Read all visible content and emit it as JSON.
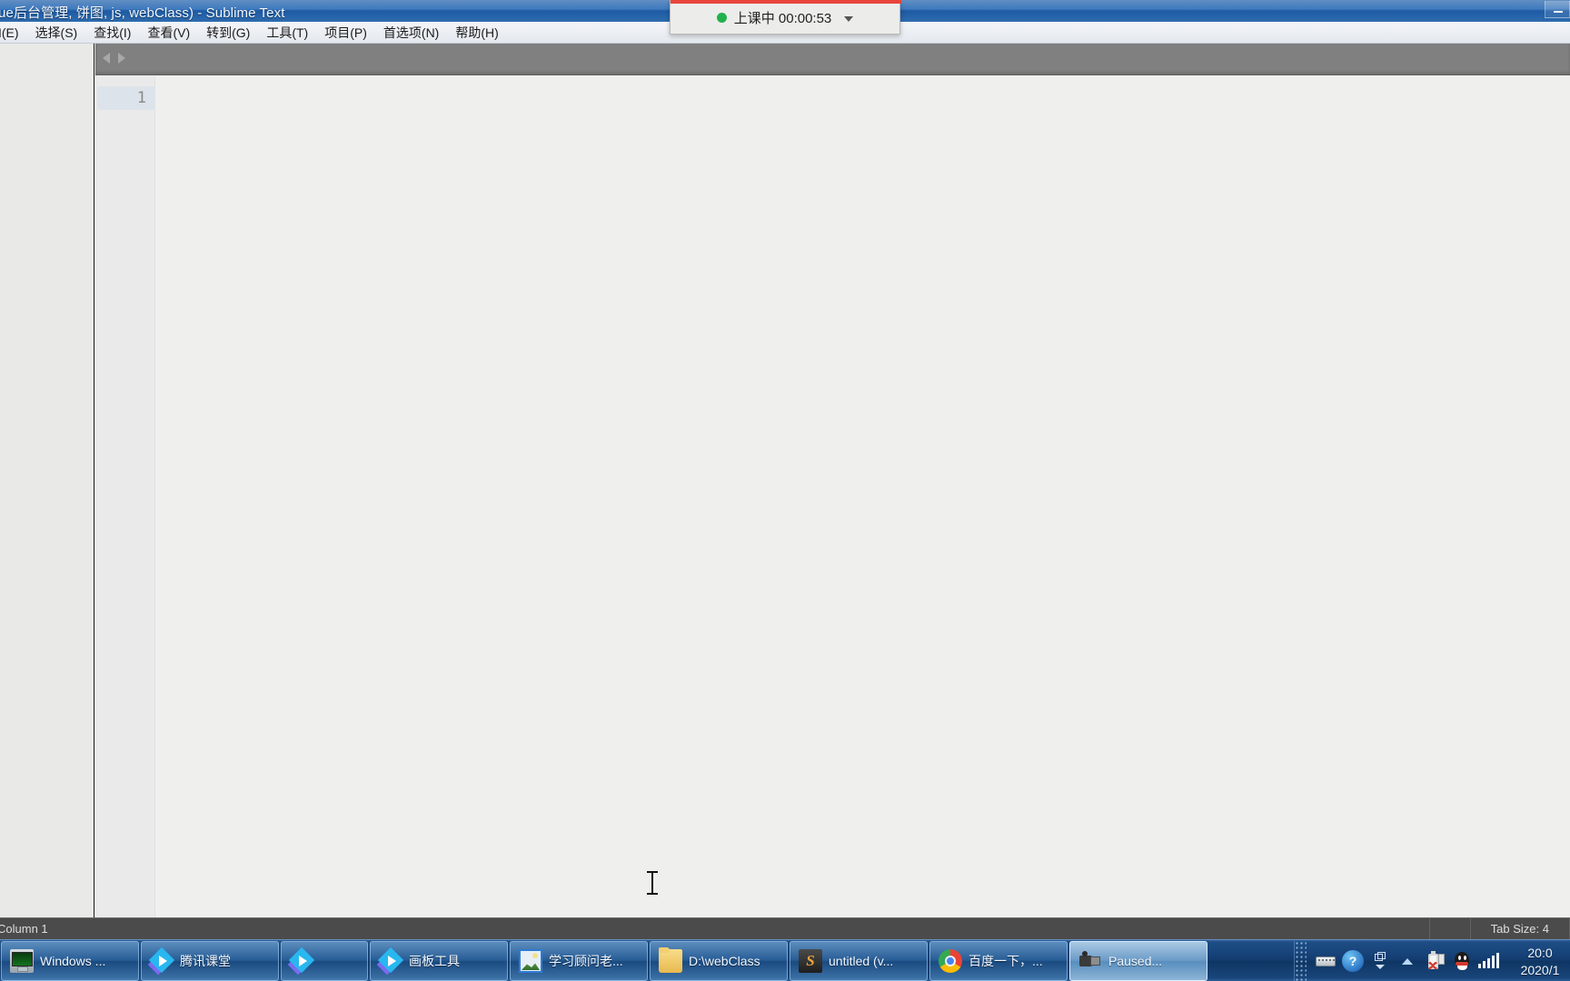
{
  "window": {
    "title": "ue后台管理, 饼图, js, webClass) - Sublime Text",
    "minimize_label": ""
  },
  "menubar": {
    "items": [
      {
        "label": "I(E)"
      },
      {
        "label": "选择(S)"
      },
      {
        "label": "查找(I)"
      },
      {
        "label": "查看(V)"
      },
      {
        "label": "转到(G)"
      },
      {
        "label": "工具(T)"
      },
      {
        "label": "项目(P)"
      },
      {
        "label": "首选项(N)"
      },
      {
        "label": "帮助(H)"
      }
    ]
  },
  "editor": {
    "line_number": "1",
    "content": ""
  },
  "statusbar": {
    "left": "Column 1",
    "right_cells": [
      {
        "label": ""
      },
      {
        "label": "Tab Size: 4"
      }
    ]
  },
  "class_widget": {
    "status_label": "上课中 00:00:53",
    "dot_color": "#21b14b",
    "accent_color": "#e8463c"
  },
  "taskbar": {
    "buttons": [
      {
        "label": "Windows ...",
        "icon": "monitor-icon",
        "active": false,
        "narrow": false
      },
      {
        "label": "腾讯课堂",
        "icon": "tencent-classroom-icon",
        "active": false,
        "narrow": false
      },
      {
        "label": "",
        "icon": "tencent-classroom-icon",
        "active": false,
        "narrow": true
      },
      {
        "label": "画板工具",
        "icon": "tencent-classroom-icon",
        "active": false,
        "narrow": false
      },
      {
        "label": "学习顾问老...",
        "icon": "photo-icon",
        "active": false,
        "narrow": false
      },
      {
        "label": "D:\\webClass",
        "icon": "folder-icon",
        "active": false,
        "narrow": false
      },
      {
        "label": "untitled (v...",
        "icon": "sublime-icon",
        "active": false,
        "narrow": false
      },
      {
        "label": "百度一下，...",
        "icon": "chrome-icon",
        "active": false,
        "narrow": false
      },
      {
        "label": "Paused...",
        "icon": "camcorder-icon",
        "active": true,
        "narrow": false
      }
    ],
    "tray": {
      "icons": [
        {
          "name": "keyboard-icon"
        },
        {
          "name": "help-icon"
        },
        {
          "name": "restore-icon"
        },
        {
          "name": "show-hidden-icons-icon"
        },
        {
          "name": "battery-icon"
        },
        {
          "name": "qq-icon"
        },
        {
          "name": "network-signal-icon"
        }
      ],
      "clock_time": "20:0",
      "clock_date": "2020/1"
    }
  }
}
